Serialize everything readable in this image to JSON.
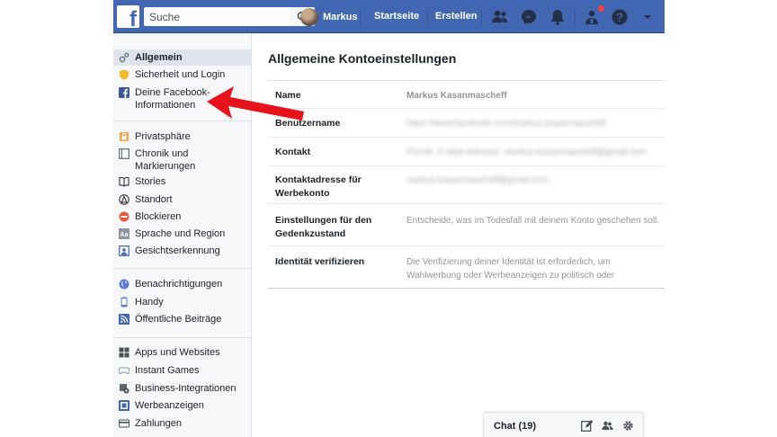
{
  "topbar": {
    "logo": "f",
    "search_placeholder": "Suche",
    "user_name": "Markus",
    "home": "Startseite",
    "create": "Erstellen",
    "icons": [
      "friends-icon",
      "messenger-icon",
      "notifications-icon",
      "quick-help-icon",
      "help-icon",
      "dropdown-icon"
    ]
  },
  "sidebar": {
    "items": [
      {
        "label": "Allgemein",
        "icon": "gear-icon",
        "active": true
      },
      {
        "label": "Sicherheit und Login",
        "icon": "shield-icon"
      },
      {
        "label": "Deine Facebook-Informationen",
        "icon": "facebook-icon"
      },
      {
        "label": "Privatsphäre",
        "icon": "lock-icon"
      },
      {
        "label": "Chronik und Markierungen",
        "icon": "timeline-icon"
      },
      {
        "label": "Stories",
        "icon": "book-icon"
      },
      {
        "label": "Standort",
        "icon": "location-icon"
      },
      {
        "label": "Blockieren",
        "icon": "block-icon"
      },
      {
        "label": "Sprache und Region",
        "icon": "language-icon"
      },
      {
        "label": "Gesichtserkennung",
        "icon": "face-icon"
      },
      {
        "label": "Benachrichtigungen",
        "icon": "globe-icon"
      },
      {
        "label": "Handy",
        "icon": "phone-icon"
      },
      {
        "label": "Öffentliche Beiträge",
        "icon": "rss-icon"
      },
      {
        "label": "Apps und Websites",
        "icon": "apps-icon"
      },
      {
        "label": "Instant Games",
        "icon": "gamepad-icon"
      },
      {
        "label": "Business-Integrationen",
        "icon": "business-icon"
      },
      {
        "label": "Werbeanzeigen",
        "icon": "ads-icon"
      },
      {
        "label": "Zahlungen",
        "icon": "payment-icon"
      }
    ]
  },
  "main": {
    "title": "Allgemeine Kontoeinstellungen",
    "rows": [
      {
        "label": "Name",
        "value": "Markus Kasanmascheff"
      },
      {
        "label": "Benutzername",
        "value": "https://www.facebook.com/markus.kasanmascheff"
      },
      {
        "label": "Kontakt",
        "value": "Primär: E-Mail-Adresse: markus.kasanmascheff@gmail.com"
      },
      {
        "label": "Kontaktadresse für Werbekonto",
        "value": "markus.kasanmascheff@gmail.com"
      },
      {
        "label": "Einstellungen für den Gedenkzustand",
        "value": "Entscheide, was im Todesfall mit deinem Konto geschehen soll."
      },
      {
        "label": "Identität verifizieren",
        "value": "Die Verifizierung deiner Identität ist erforderlich, um Wahlwerbung oder Werbeanzeigen zu politisch oder gesellschaftlich relevanten Themen zu schalten."
      }
    ]
  },
  "chat": {
    "label": "Chat (19)"
  },
  "colors": {
    "brand": "#4267b2",
    "arrow": "#e8121b"
  }
}
